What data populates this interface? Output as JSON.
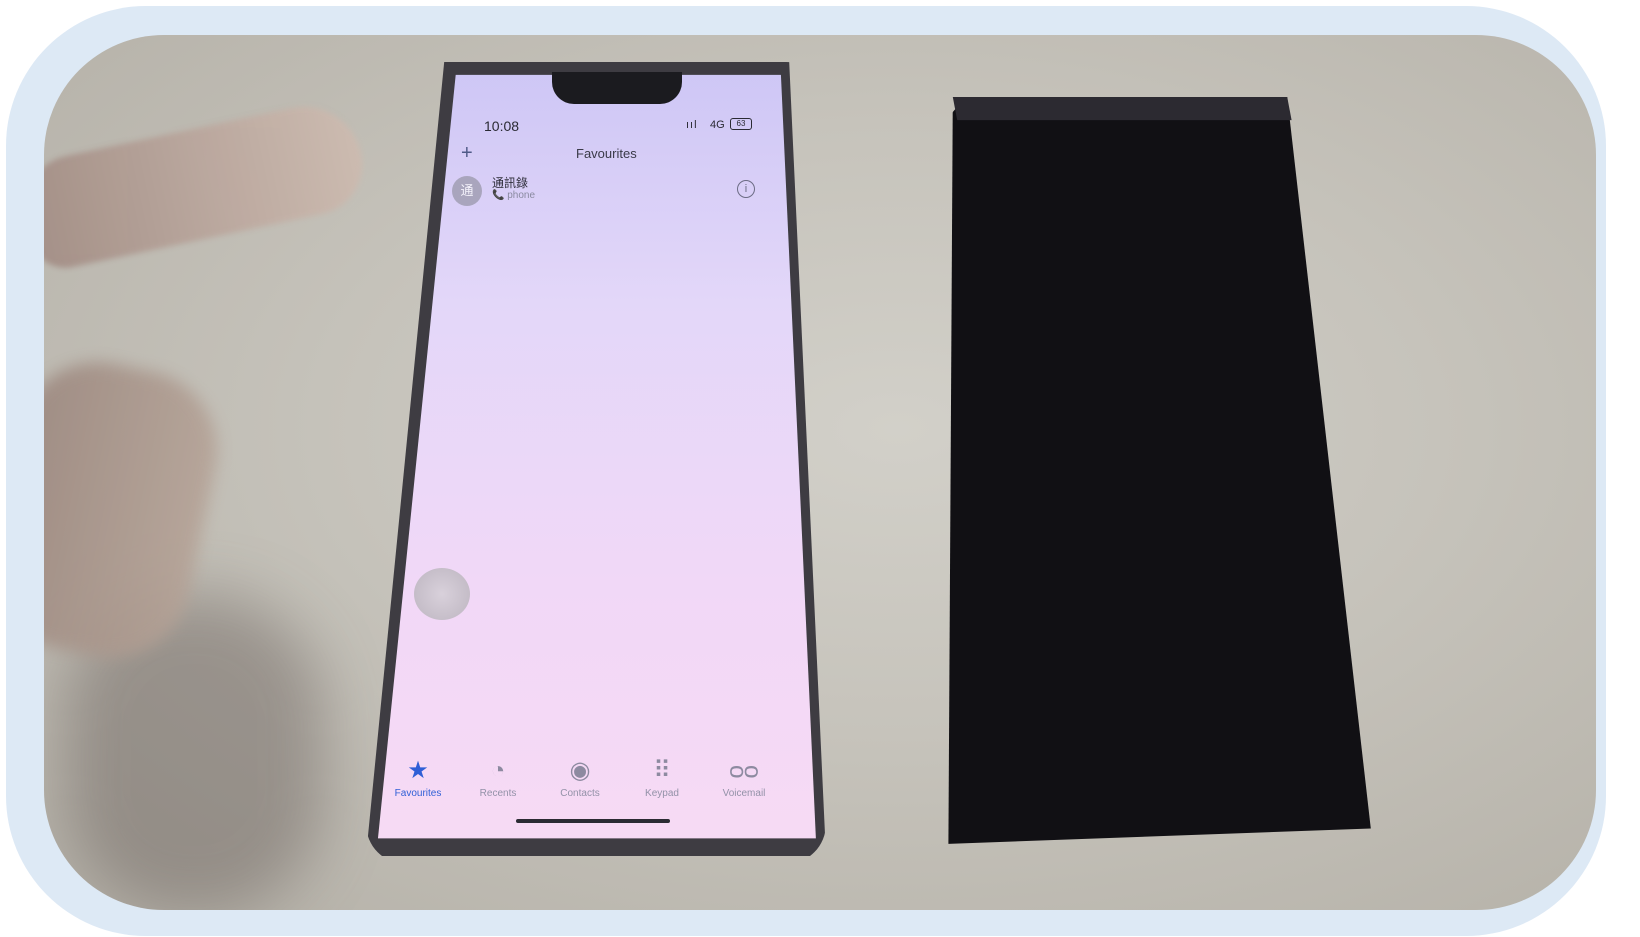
{
  "scene": {
    "left_phone": {
      "status_bar": {
        "time": "10:08",
        "signal": "ııl",
        "network": "4G",
        "battery": "63"
      },
      "nav": {
        "add_glyph": "+",
        "title": "Favourites"
      },
      "favourite": {
        "avatar_text": "通",
        "name": "通訊錄",
        "subtitle": "📞 phone",
        "info_glyph": "i"
      },
      "tabs": [
        {
          "label": "Favourites",
          "icon": "star-icon",
          "glyph": "★",
          "active": true
        },
        {
          "label": "Recents",
          "icon": "clock-icon",
          "glyph": "◔",
          "active": false
        },
        {
          "label": "Contacts",
          "icon": "person-circle-icon",
          "glyph": "◉",
          "active": false
        },
        {
          "label": "Keypad",
          "icon": "keypad-icon",
          "glyph": "⠿",
          "active": false
        },
        {
          "label": "Voicemail",
          "icon": "voicemail-icon",
          "glyph": "ᴑᴑ",
          "active": false
        }
      ]
    },
    "right_phone": {
      "screen_state": "off"
    },
    "colors": {
      "active_tab": "#2f5fd6",
      "frame_border": "#dde9f5"
    }
  }
}
